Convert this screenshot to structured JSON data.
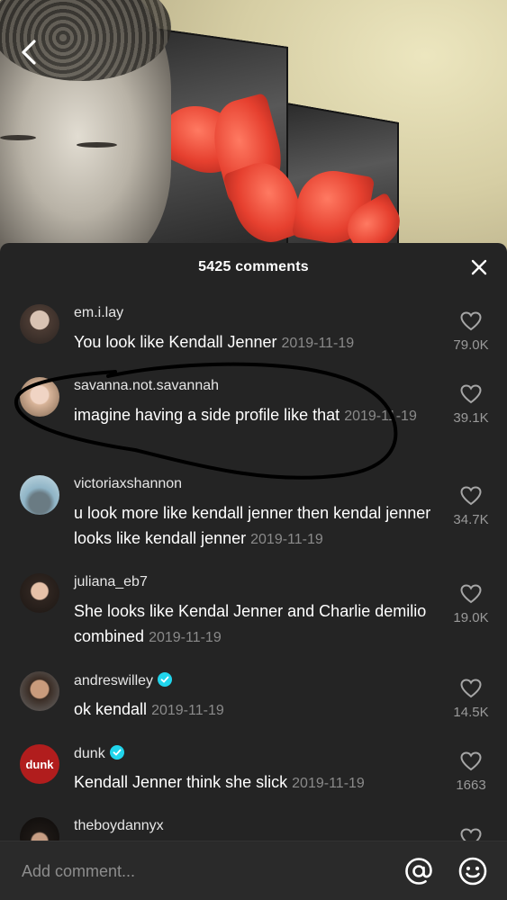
{
  "header": {
    "comments_count": "5425 comments"
  },
  "comments": [
    {
      "username": "em.i.lay",
      "text": "You look like Kendall Jenner",
      "date": "2019-11-19",
      "likes": "79.0K",
      "verified": false
    },
    {
      "username": "savanna.not.savannah",
      "text": "imagine having a side profile like that",
      "date": "2019-11-19",
      "likes": "39.1K",
      "verified": false
    },
    {
      "username": "victoriaxshannon",
      "text": "u look more like kendall jenner then kendal jenner looks like kendall jenner",
      "date": "2019-11-19",
      "likes": "34.7K",
      "verified": false
    },
    {
      "username": "juliana_eb7",
      "text": "She looks like Kendal Jenner and Charlie demilio combined",
      "date": "2019-11-19",
      "likes": "19.0K",
      "verified": false
    },
    {
      "username": "andreswilley",
      "text": "ok kendall",
      "date": "2019-11-19",
      "likes": "14.5K",
      "verified": true
    },
    {
      "username": "dunk",
      "text": "Kendall Jenner think she slick",
      "date": "2019-11-19",
      "likes": "1663",
      "verified": true,
      "avatar_text": "dunk"
    },
    {
      "username": "theboydannyx",
      "text": "",
      "date": "",
      "likes": "",
      "verified": false
    }
  ],
  "input": {
    "placeholder": "Add comment..."
  },
  "colors": {
    "sheet_bg": "#242424",
    "verified": "#20d5ec",
    "dunk_avatar": "#b11d1d"
  },
  "icons": [
    "back-chevron-icon",
    "close-icon",
    "heart-icon",
    "verified-icon",
    "at-mention-icon",
    "emoji-icon"
  ]
}
